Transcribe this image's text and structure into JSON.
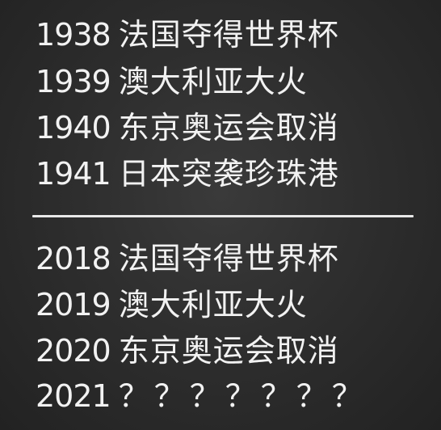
{
  "history": [
    {
      "year": "1938",
      "event": "法国夺得世界杯"
    },
    {
      "year": "1939",
      "event": "澳大利亚大火"
    },
    {
      "year": "1940",
      "event": "东京奥运会取消"
    },
    {
      "year": "1941",
      "event": "日本突袭珍珠港"
    }
  ],
  "recent": [
    {
      "year": "2018",
      "event": "法国夺得世界杯"
    },
    {
      "year": "2019",
      "event": "澳大利亚大火"
    },
    {
      "year": "2020",
      "event": "东京奥运会取消"
    },
    {
      "year": "2021",
      "event": "？？？？？？？"
    }
  ],
  "colors": {
    "background": "#2e2e2e",
    "text": "#f2f2f2",
    "divider": "#e8e8e8"
  }
}
